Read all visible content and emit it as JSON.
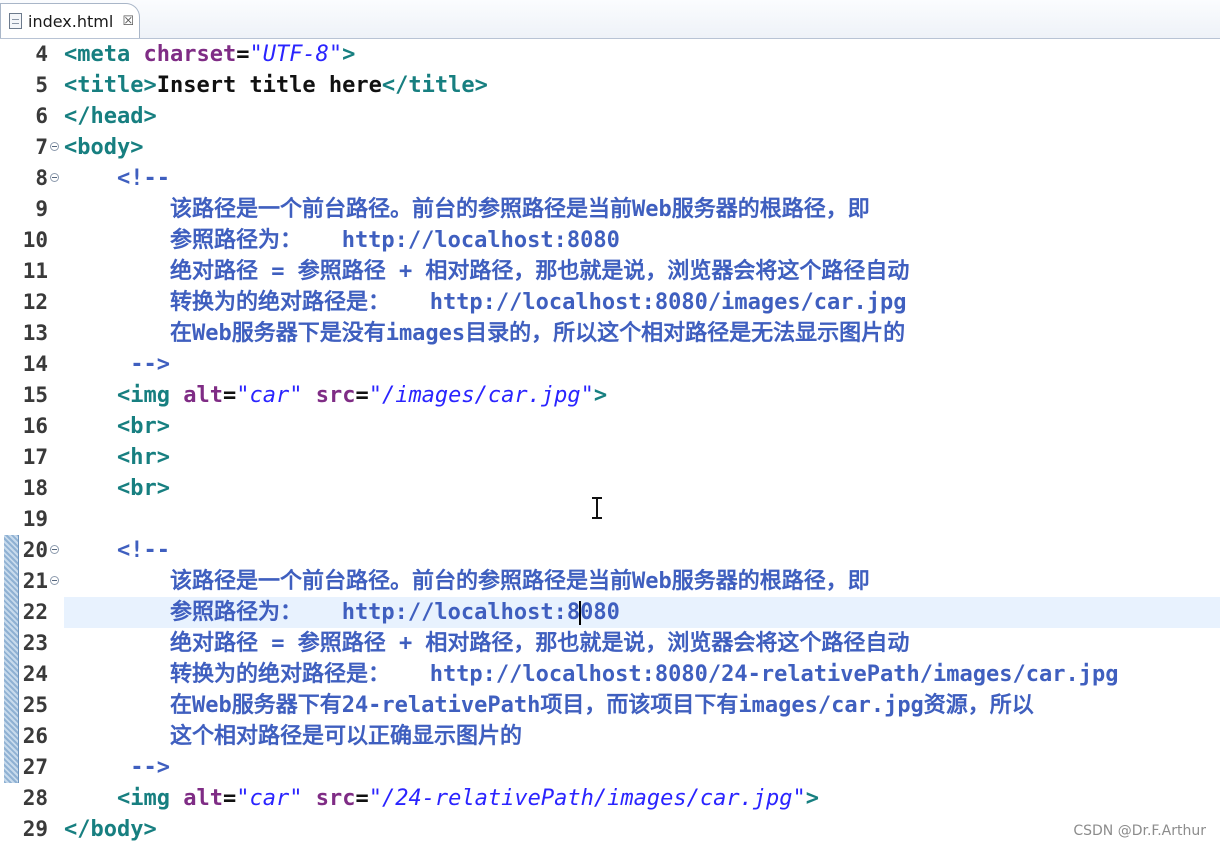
{
  "tab": {
    "title": "index.html",
    "close_glyph": "☒",
    "icon": "file-icon"
  },
  "colors": {
    "tag": "#177f80",
    "attribute": "#7f2c85",
    "value": "#2a24ff",
    "comment": "#3f5fbf",
    "current_line": "#e8f2fe"
  },
  "lines": [
    {
      "num": "4",
      "fold": false,
      "segs": [
        [
          "tag",
          "<meta "
        ],
        [
          "attr",
          "charset"
        ],
        [
          "plain",
          "="
        ],
        [
          "val",
          "\"UTF-8\""
        ],
        [
          "tag",
          ">"
        ]
      ]
    },
    {
      "num": "5",
      "fold": false,
      "segs": [
        [
          "tag",
          "<title>"
        ],
        [
          "plain",
          "Insert title here"
        ],
        [
          "tag",
          "</title>"
        ]
      ]
    },
    {
      "num": "6",
      "fold": false,
      "segs": [
        [
          "tag",
          "</head>"
        ]
      ]
    },
    {
      "num": "7",
      "fold": true,
      "segs": [
        [
          "tag",
          "<body>"
        ]
      ]
    },
    {
      "num": "8",
      "fold": true,
      "segs": [
        [
          "cmt",
          "    <!--"
        ]
      ]
    },
    {
      "num": "9",
      "fold": false,
      "segs": [
        [
          "cmt",
          "        该路径是一个前台路径。前台的参照路径是当前Web服务器的根路径，即"
        ]
      ]
    },
    {
      "num": "10",
      "fold": false,
      "segs": [
        [
          "cmt",
          "        参照路径为：   http://localhost:8080"
        ]
      ]
    },
    {
      "num": "11",
      "fold": false,
      "segs": [
        [
          "cmt",
          "        绝对路径 = 参照路径 + 相对路径，那也就是说，浏览器会将这个路径自动"
        ]
      ]
    },
    {
      "num": "12",
      "fold": false,
      "segs": [
        [
          "cmt",
          "        转换为的绝对路径是：   http://localhost:8080/images/car.jpg"
        ]
      ]
    },
    {
      "num": "13",
      "fold": false,
      "segs": [
        [
          "cmt",
          "        在Web服务器下是没有images目录的，所以这个相对路径是无法显示图片的"
        ]
      ]
    },
    {
      "num": "14",
      "fold": false,
      "segs": [
        [
          "cmt",
          "     -->"
        ]
      ]
    },
    {
      "num": "15",
      "fold": false,
      "segs": [
        [
          "plain",
          "    "
        ],
        [
          "tag",
          "<img "
        ],
        [
          "attr",
          "alt"
        ],
        [
          "plain",
          "="
        ],
        [
          "val",
          "\"car\""
        ],
        [
          "plain",
          " "
        ],
        [
          "attr",
          "src"
        ],
        [
          "plain",
          "="
        ],
        [
          "val",
          "\"/images/car.jpg\""
        ],
        [
          "tag",
          ">"
        ]
      ]
    },
    {
      "num": "16",
      "fold": false,
      "segs": [
        [
          "plain",
          "    "
        ],
        [
          "tag",
          "<br>"
        ]
      ]
    },
    {
      "num": "17",
      "fold": false,
      "segs": [
        [
          "plain",
          "    "
        ],
        [
          "tag",
          "<hr>"
        ]
      ]
    },
    {
      "num": "18",
      "fold": false,
      "segs": [
        [
          "plain",
          "    "
        ],
        [
          "tag",
          "<br>"
        ]
      ]
    },
    {
      "num": "19",
      "fold": false,
      "segs": []
    },
    {
      "num": "20",
      "fold": true,
      "segs": [
        [
          "cmt",
          "    <!--"
        ]
      ]
    },
    {
      "num": "21",
      "fold": true,
      "segs": [
        [
          "cmt",
          "        该路径是一个前台路径。前台的参照路径是当前Web服务器的根路径，即"
        ]
      ]
    },
    {
      "num": "22",
      "fold": false,
      "current": true,
      "segs": [
        [
          "cmt",
          "        参照路径为：   http://localhost:8"
        ],
        [
          "caret",
          ""
        ],
        [
          "cmt",
          "080"
        ]
      ]
    },
    {
      "num": "23",
      "fold": false,
      "segs": [
        [
          "cmt",
          "        绝对路径 = 参照路径 + 相对路径，那也就是说，浏览器会将这个路径自动"
        ]
      ]
    },
    {
      "num": "24",
      "fold": false,
      "segs": [
        [
          "cmt",
          "        转换为的绝对路径是：   http://localhost:8080/24-relativePath/images/car.jpg"
        ]
      ]
    },
    {
      "num": "25",
      "fold": false,
      "segs": [
        [
          "cmt",
          "        在Web服务器下有24-relativePath项目，而该项目下有images/car.jpg资源，所以"
        ]
      ]
    },
    {
      "num": "26",
      "fold": false,
      "segs": [
        [
          "cmt",
          "        这个相对路径是可以正确显示图片的"
        ]
      ]
    },
    {
      "num": "27",
      "fold": false,
      "segs": [
        [
          "cmt",
          "     -->"
        ]
      ]
    },
    {
      "num": "28",
      "fold": false,
      "segs": [
        [
          "plain",
          "    "
        ],
        [
          "tag",
          "<img "
        ],
        [
          "attr",
          "alt"
        ],
        [
          "plain",
          "="
        ],
        [
          "val",
          "\"car\""
        ],
        [
          "plain",
          " "
        ],
        [
          "attr",
          "src"
        ],
        [
          "plain",
          "="
        ],
        [
          "val",
          "\"/24-relativePath/images/car.jpg\""
        ],
        [
          "tag",
          ">"
        ]
      ]
    },
    {
      "num": "29",
      "fold": false,
      "segs": [
        [
          "tag",
          "</body>"
        ]
      ]
    }
  ],
  "watermark": "CSDN @Dr.F.Arthur"
}
